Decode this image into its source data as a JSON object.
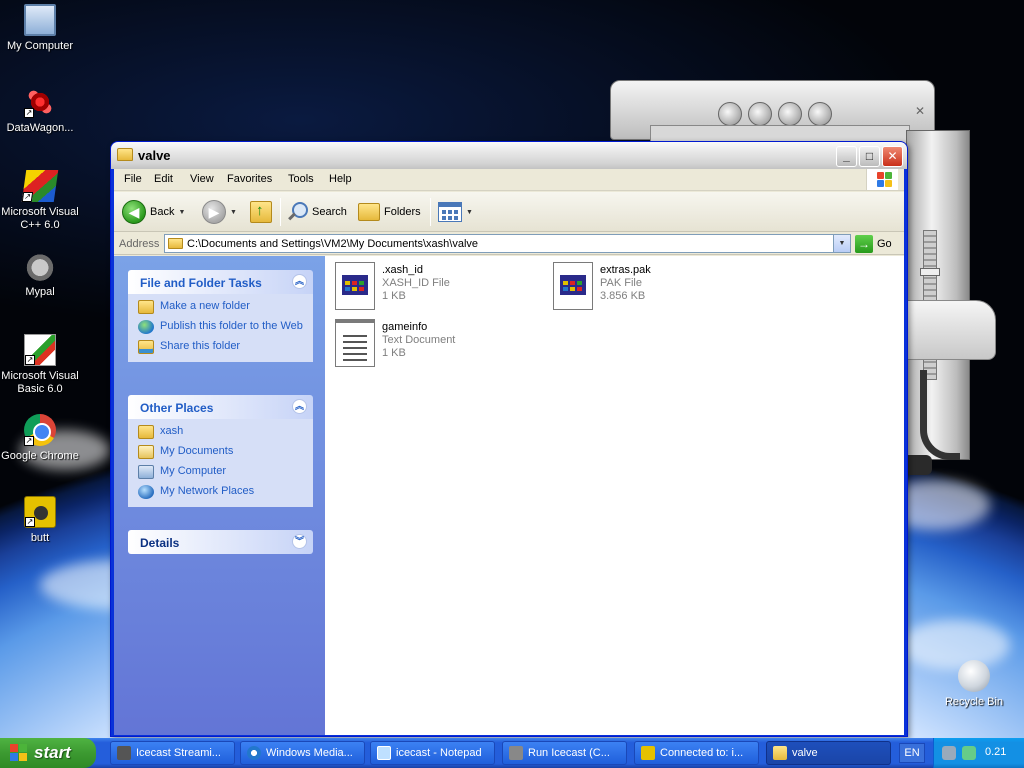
{
  "desktop": {
    "icons": [
      {
        "label": "My Computer",
        "icon": "my-computer-icon"
      },
      {
        "label": "DataWagon...",
        "icon": "datawagon-icon"
      },
      {
        "label": "Microsoft Visual C++ 6.0",
        "icon": "visual-cpp-icon"
      },
      {
        "label": "Mypal",
        "icon": "mypal-icon"
      },
      {
        "label": "Microsoft Visual Basic 6.0",
        "icon": "visual-basic-icon"
      },
      {
        "label": "Google Chrome",
        "icon": "chrome-icon"
      },
      {
        "label": "butt",
        "icon": "butt-icon"
      },
      {
        "label": "Recycle Bin",
        "icon": "recycle-bin-icon"
      }
    ]
  },
  "window": {
    "title": "valve",
    "menu": [
      "File",
      "Edit",
      "View",
      "Favorites",
      "Tools",
      "Help"
    ],
    "toolbar": {
      "back": "Back",
      "search": "Search",
      "folders": "Folders"
    },
    "address": {
      "label": "Address",
      "path": "C:\\Documents and Settings\\VM2\\My Documents\\xash\\valve",
      "go": "Go"
    },
    "taskpane": {
      "file_tasks": {
        "title": "File and Folder Tasks",
        "items": [
          "Make a new folder",
          "Publish this folder to the Web",
          "Share this folder"
        ]
      },
      "other_places": {
        "title": "Other Places",
        "items": [
          "xash",
          "My Documents",
          "My Computer",
          "My Network Places"
        ]
      },
      "details": {
        "title": "Details"
      }
    },
    "files": [
      {
        "name": ".xash_id",
        "type": "XASH_ID File",
        "size": "1 KB",
        "icon": "generic-file-icon"
      },
      {
        "name": "extras.pak",
        "type": "PAK File",
        "size": "3.856 KB",
        "icon": "generic-file-icon"
      },
      {
        "name": "gameinfo",
        "type": "Text Document",
        "size": "1 KB",
        "icon": "text-document-icon"
      }
    ]
  },
  "taskbar": {
    "start": "start",
    "tasks": [
      {
        "label": "Icecast Streami...",
        "icon": "icecast-icon"
      },
      {
        "label": "Windows Media...",
        "icon": "windows-media-icon"
      },
      {
        "label": "icecast - Notepad",
        "icon": "notepad-icon"
      },
      {
        "label": "Run Icecast (C...",
        "icon": "run-icecast-icon"
      },
      {
        "label": "Connected to: i...",
        "icon": "connected-icon"
      },
      {
        "label": "valve",
        "icon": "folder-icon"
      }
    ],
    "language": "EN",
    "clock": "0.21"
  }
}
